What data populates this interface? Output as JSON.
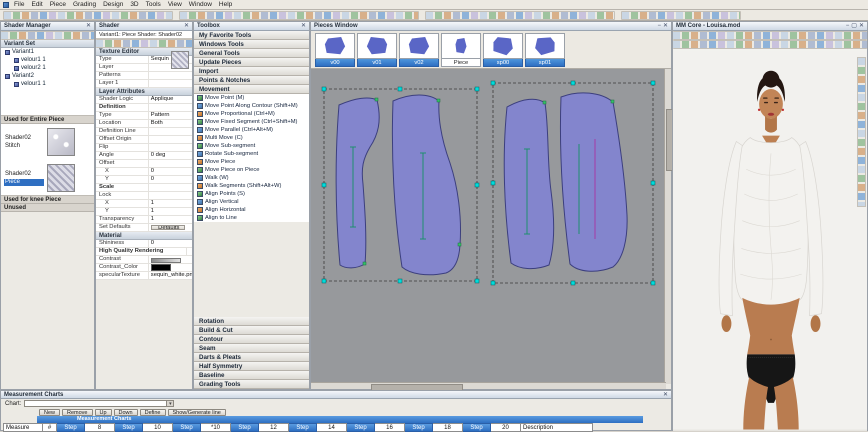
{
  "icons": {
    "close": "✕",
    "minimize": "−",
    "maximize": "▢",
    "dropdown": "▾"
  },
  "window": {
    "menu_items": [
      "File",
      "Edit",
      "Piece",
      "Grading",
      "Design",
      "3D",
      "Tools",
      "View",
      "Window",
      "Help"
    ]
  },
  "shader_manager": {
    "title": "Shader Manager",
    "variant_set_label": "Variant Set",
    "variant_tree": [
      {
        "label": "Variant1",
        "child": false
      },
      {
        "label": "velour1 1",
        "child": true
      },
      {
        "label": "velour2 1",
        "child": true
      },
      {
        "label": "Variant2",
        "child": false
      },
      {
        "label": "velour1 1",
        "child": true
      }
    ],
    "groups": [
      {
        "label": "Used for Entire Piece"
      },
      {
        "label": "Used for knee Piece"
      },
      {
        "label": "Unused"
      }
    ],
    "shader_items": [
      {
        "name": "Shader02",
        "part": "Stitch",
        "selected": false
      },
      {
        "name": "Shader02",
        "part": "Piece",
        "selected": true
      }
    ]
  },
  "shader_panel": {
    "title": "Shader",
    "subtitle": "Variant1: Piece Shader: Shader02",
    "section_texture": "Texture Editor",
    "section_layer": "Layer Attributes",
    "section_material": "Material",
    "rows_texture": [
      {
        "label": "Type",
        "value": "Sequin"
      },
      {
        "label": "Layer",
        "value": ""
      },
      {
        "label": "Patterns",
        "value": ""
      },
      {
        "label": "Layer  1",
        "value": ""
      }
    ],
    "rows_layer": [
      {
        "label": "Shader Logic",
        "value": "Applique"
      },
      {
        "label": "Definition",
        "value": ""
      },
      {
        "label": "Type",
        "value": "Pattern"
      },
      {
        "label": "Location",
        "value": "Both"
      },
      {
        "label": "Definition Line",
        "value": ""
      },
      {
        "label": "Offset Origin",
        "value": ""
      },
      {
        "label": "Flip",
        "value": ""
      },
      {
        "label": "Angle",
        "value": "0 deg"
      },
      {
        "label": "Offset",
        "value": ""
      },
      {
        "label": "X",
        "value": "0"
      },
      {
        "label": "Y",
        "value": "0"
      },
      {
        "label": "Scale",
        "value": ""
      },
      {
        "label": "Lock",
        "value": ""
      },
      {
        "label": "X",
        "value": "1"
      },
      {
        "label": "Y",
        "value": "1"
      },
      {
        "label": "Transparency",
        "value": "1"
      },
      {
        "label": "Set Defaults",
        "value": "Defaults"
      }
    ],
    "rows_material": [
      {
        "label": "Shininess",
        "value": "0"
      },
      {
        "label": "High Quality Rendering",
        "value": ""
      },
      {
        "label": "Contrast",
        "value": ""
      },
      {
        "label": "Contrast_Color",
        "value": ""
      },
      {
        "label": "specularTexture",
        "value": "sequin_white.png"
      }
    ]
  },
  "toolbox": {
    "title": "Toolbox",
    "top_categories": [
      "My Favorite Tools",
      "Windows Tools",
      "General Tools",
      "Update Pieces",
      "Import",
      "Points & Notches"
    ],
    "movement_header": "Movement",
    "movement_tools": [
      "Move Point (M)",
      "Move Point Along Contour (Shift+M)",
      "Move Proportional (Ctrl+M)",
      "Move Fixed Segment (Ctrl+Shift+M)",
      "Move Parallel (Ctrl+Alt+M)",
      "Multi Move (C)",
      "Move Sub-segment",
      "Rotate Sub-segment",
      "Move Piece",
      "Move Piece on Piece",
      "Walk (W)",
      "Walk Segments (Shift+Alt+W)",
      "Align Points (S)",
      "Align Vertical",
      "Align Horizontal",
      "Align to Line"
    ],
    "bottom_categories": [
      "Rotation",
      "Build & Cut",
      "Contour",
      "Seam",
      "Darts & Pleats",
      "Half Symmetry",
      "Baseline",
      "Grading Tools"
    ]
  },
  "pieces_window": {
    "title": "Pieces Window",
    "tiles": [
      {
        "label": "v00",
        "selected": true
      },
      {
        "label": "v01",
        "selected": true
      },
      {
        "label": "v02",
        "selected": true
      },
      {
        "label": "Piece",
        "selected": false
      },
      {
        "label": "sp00",
        "selected": true
      },
      {
        "label": "sp01",
        "selected": true
      }
    ]
  },
  "viewer3d": {
    "title": "MM Core - Louisa.mod"
  },
  "measurement": {
    "title": "Measurement Charts",
    "chart_label": "Chart:",
    "buttons": [
      "New",
      "Remove",
      "Up",
      "Down",
      "Define",
      "Show/Generate line"
    ],
    "selected_row_label": "Measurement Charts",
    "header_cells": [
      {
        "label": "Measure",
        "blue": false
      },
      {
        "label": "#",
        "blue": false
      },
      {
        "label": "Step",
        "blue": true
      },
      {
        "label": "8",
        "blue": false
      },
      {
        "label": "Step",
        "blue": true
      },
      {
        "label": "10",
        "blue": false
      },
      {
        "label": "Step",
        "blue": true
      },
      {
        "label": "*10",
        "blue": false
      },
      {
        "label": "Step",
        "blue": true
      },
      {
        "label": "12",
        "blue": false
      },
      {
        "label": "Step",
        "blue": true
      },
      {
        "label": "14",
        "blue": false
      },
      {
        "label": "Step",
        "blue": true
      },
      {
        "label": "16",
        "blue": false
      },
      {
        "label": "Step",
        "blue": true
      },
      {
        "label": "18",
        "blue": false
      },
      {
        "label": "Step",
        "blue": true
      },
      {
        "label": "20",
        "blue": false
      },
      {
        "label": "Description",
        "blue": false
      }
    ]
  },
  "colors": {
    "piece_fill": "#8385cd",
    "piece_outline": "#3c3f7e",
    "selection_handle": "#00dcdc",
    "grain_line": "#1f8f6f",
    "table_blue": "#2d6fc2"
  }
}
